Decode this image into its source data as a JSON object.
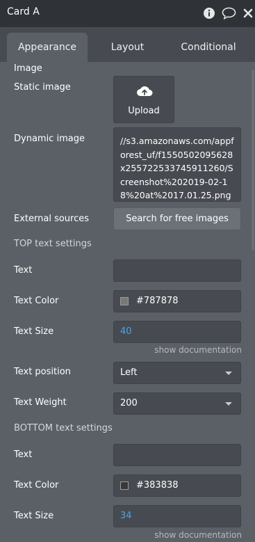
{
  "window": {
    "title": "Card A"
  },
  "tabs": [
    {
      "label": "Appearance"
    },
    {
      "label": "Layout"
    },
    {
      "label": "Conditional"
    }
  ],
  "image": {
    "section_label": "Image",
    "static_label": "Static image",
    "upload_label": "Upload",
    "dynamic_label": "Dynamic image",
    "dynamic_value": "//s3.amazonaws.com/appforest_uf/f1550502095628x255722533745911260/Screenshot%202019-02-18%20at%2017.01.25.png",
    "external_label": "External sources",
    "search_button": "Search for free images"
  },
  "top": {
    "section_label": "TOP text settings",
    "text_label": "Text",
    "text_value": "",
    "color_label": "Text Color",
    "color_value": "#787878",
    "size_label": "Text Size",
    "size_value": "40",
    "doc_link": "show documentation",
    "position_label": "Text position",
    "position_value": "Left",
    "weight_label": "Text Weight",
    "weight_value": "200"
  },
  "bottom": {
    "section_label": "BOTTOM text settings",
    "text_label": "Text",
    "text_value": "",
    "color_label": "Text Color",
    "color_value": "#383838",
    "size_label": "Text Size",
    "size_value": "34",
    "doc_link": "show documentation"
  },
  "colors": {
    "accent_number": "#4aa3e8",
    "panel_bg": "#5b6067",
    "titlebar_bg": "#2f3236",
    "field_bg": "#474b51"
  },
  "icons": [
    "info-icon",
    "comment-icon",
    "close-icon",
    "cloud-upload-icon",
    "chevron-down-icon"
  ]
}
